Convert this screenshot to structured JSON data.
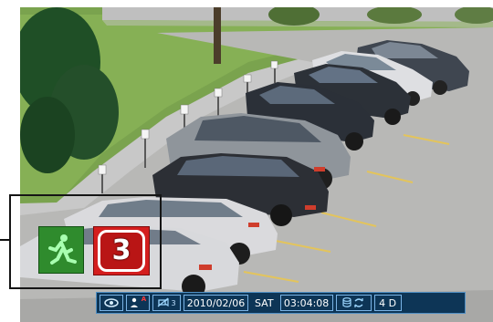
{
  "viewer": {
    "scene_description": "parking-lot-camera-view"
  },
  "overlay": {
    "channel_number": "3",
    "motion_icon": "running-person-icon",
    "zoom_panel_visible": true
  },
  "status_bar": {
    "monitor_icon": "eye-icon",
    "user_icon": "user-icon",
    "user_mark": "A",
    "camera_icon": "camera-icon",
    "camera_number": "3",
    "date": "2010/02/06",
    "day": "SAT",
    "time": "03:04:08",
    "storage_icon": "database-icon",
    "recycle_icon": "recycle-icon",
    "days_left": "4 D"
  },
  "colors": {
    "status_bg": "#0d3556",
    "status_border": "#7ab4e6",
    "motion_green": "#2f8b2d",
    "channel_red": "#d41e1e"
  }
}
